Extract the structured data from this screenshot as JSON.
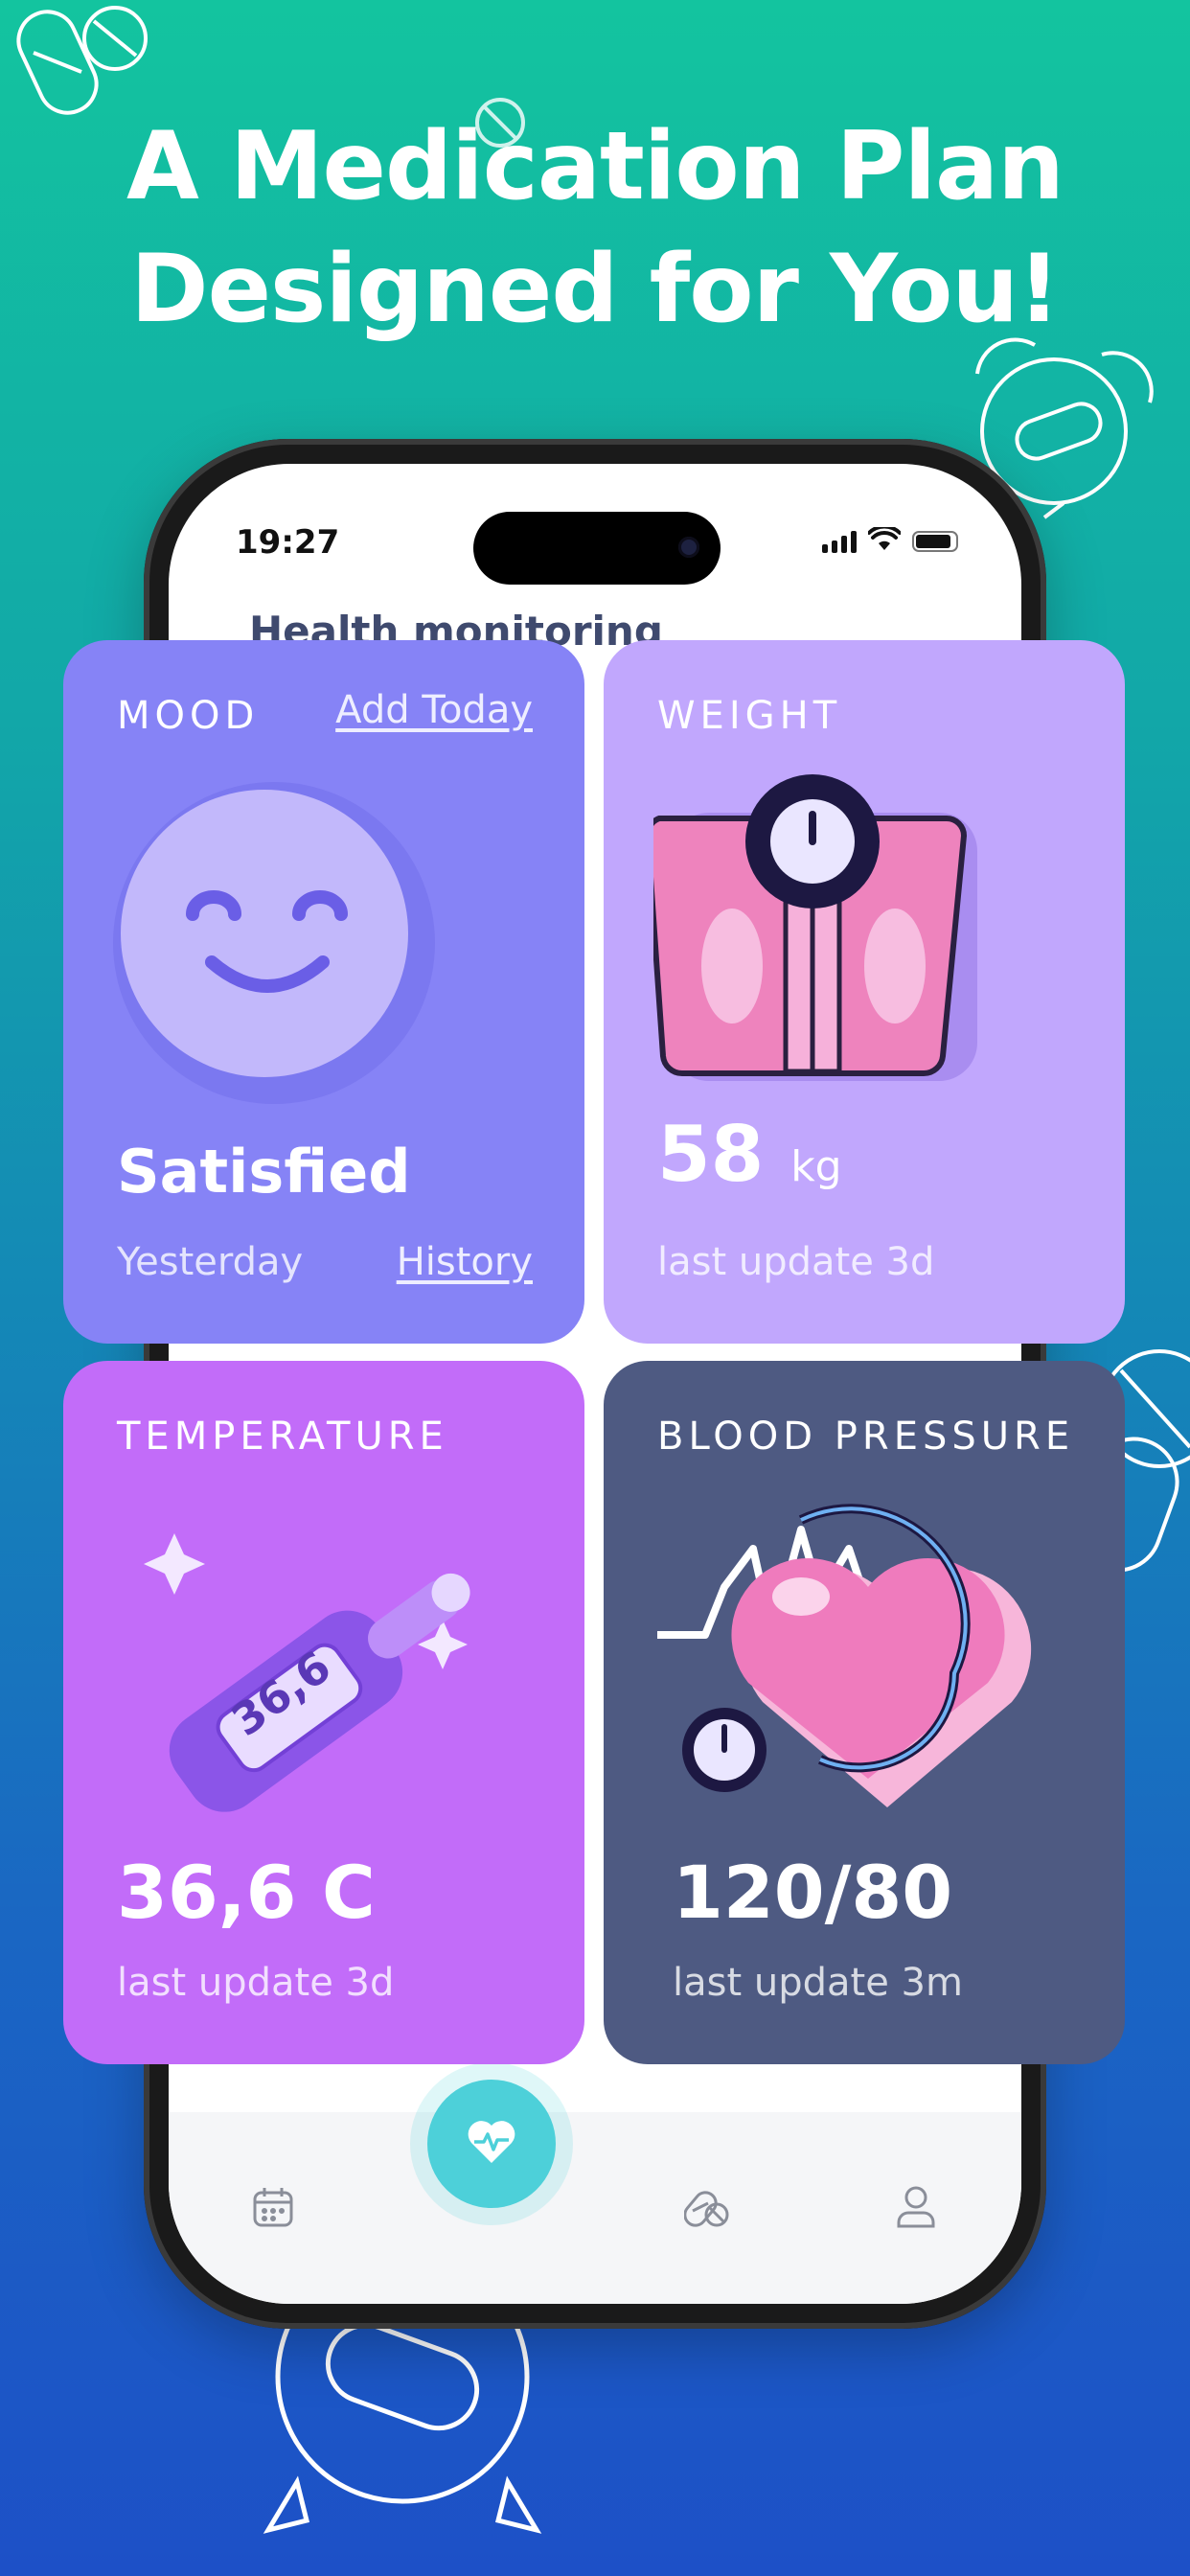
{
  "headline": {
    "line1": "A Medication Plan",
    "line2": "Designed for You!"
  },
  "status_bar": {
    "time": "19:27"
  },
  "screen": {
    "title": "Health monitoring"
  },
  "cards": {
    "mood": {
      "label": "MOOD",
      "add_link": "Add Today",
      "value": "Satisfied",
      "when": "Yesterday",
      "history_link": "History"
    },
    "weight": {
      "label": "WEIGHT",
      "value": "58",
      "unit": "kg",
      "updated": "last update 3d"
    },
    "temperature": {
      "label": "TEMPERATURE",
      "value": "36,6 C",
      "thermo_reading": "36,6",
      "updated": "last update 3d"
    },
    "blood_pressure": {
      "label": "BLOOD PRESSURE",
      "value": "120/80",
      "updated": "last update 3m"
    }
  },
  "tabbar": {
    "items": [
      {
        "icon": "calendar-icon"
      },
      {
        "icon": "heart-pulse-icon",
        "active": true
      },
      {
        "icon": "pills-icon"
      },
      {
        "icon": "user-icon"
      }
    ]
  },
  "colors": {
    "mood_card": "#8683f6",
    "weight_card": "#c1a7fd",
    "temperature_card": "#c26cf9",
    "bp_card": "#4e5a82",
    "accent": "#4dd0d9",
    "screen_title": "#3f4a6e"
  }
}
